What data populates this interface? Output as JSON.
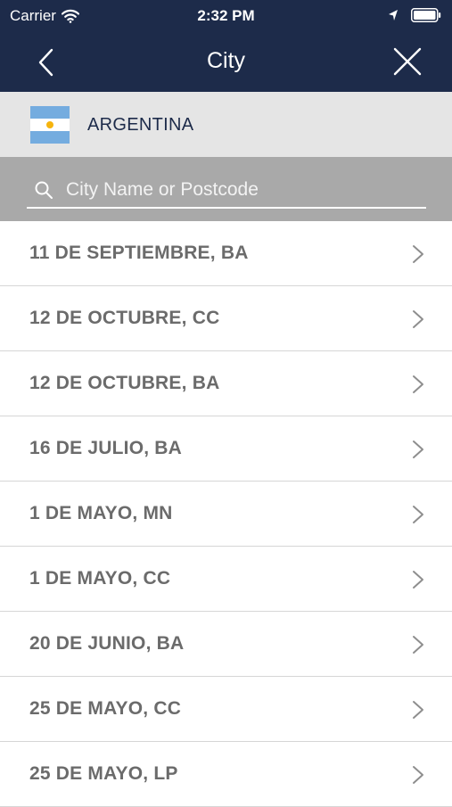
{
  "status_bar": {
    "carrier": "Carrier",
    "time": "2:32 PM"
  },
  "nav": {
    "title": "City",
    "back_icon": "chevron-left-icon",
    "close_icon": "close-icon"
  },
  "country": {
    "name": "ARGENTINA",
    "flag_icon": "argentina-flag-icon"
  },
  "search": {
    "placeholder": "City Name or Postcode",
    "value": ""
  },
  "cities": [
    {
      "label": "11 DE SEPTIEMBRE, BA"
    },
    {
      "label": "12 DE OCTUBRE, CC"
    },
    {
      "label": "12 DE OCTUBRE, BA"
    },
    {
      "label": "16 DE JULIO, BA"
    },
    {
      "label": "1 DE MAYO, MN"
    },
    {
      "label": "1 DE MAYO, CC"
    },
    {
      "label": "20 DE JUNIO, BA"
    },
    {
      "label": "25 DE MAYO, CC"
    },
    {
      "label": "25 DE MAYO, LP"
    }
  ],
  "colors": {
    "nav_background": "#1d2b4a",
    "country_background": "#e5e5e5",
    "search_background": "#a9a9a9",
    "list_text": "#6b6b6b"
  }
}
